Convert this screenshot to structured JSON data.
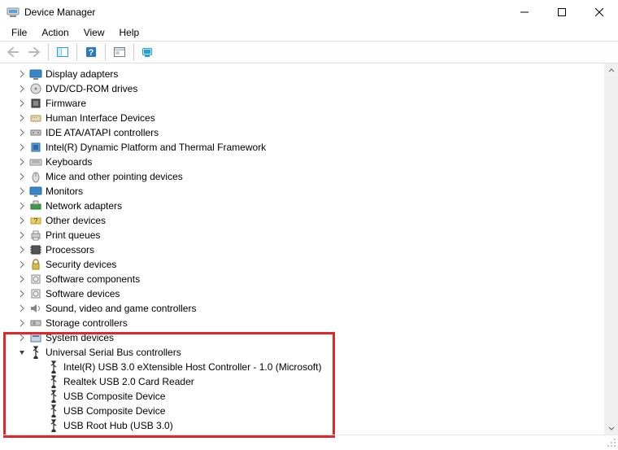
{
  "window": {
    "title": "Device Manager"
  },
  "menu": {
    "file": "File",
    "action": "Action",
    "view": "View",
    "help": "Help"
  },
  "categories": [
    {
      "label": "Display adapters",
      "icon": "display",
      "expanded": false
    },
    {
      "label": "DVD/CD-ROM drives",
      "icon": "disc",
      "expanded": false
    },
    {
      "label": "Firmware",
      "icon": "firmware",
      "expanded": false
    },
    {
      "label": "Human Interface Devices",
      "icon": "hid",
      "expanded": false
    },
    {
      "label": "IDE ATA/ATAPI controllers",
      "icon": "ide",
      "expanded": false
    },
    {
      "label": "Intel(R) Dynamic Platform and Thermal Framework",
      "icon": "chip",
      "expanded": false
    },
    {
      "label": "Keyboards",
      "icon": "keyboard",
      "expanded": false
    },
    {
      "label": "Mice and other pointing devices",
      "icon": "mouse",
      "expanded": false
    },
    {
      "label": "Monitors",
      "icon": "monitor",
      "expanded": false
    },
    {
      "label": "Network adapters",
      "icon": "network",
      "expanded": false
    },
    {
      "label": "Other devices",
      "icon": "other",
      "expanded": false
    },
    {
      "label": "Print queues",
      "icon": "printer",
      "expanded": false
    },
    {
      "label": "Processors",
      "icon": "cpu",
      "expanded": false
    },
    {
      "label": "Security devices",
      "icon": "security",
      "expanded": false
    },
    {
      "label": "Software components",
      "icon": "sw",
      "expanded": false
    },
    {
      "label": "Software devices",
      "icon": "sw",
      "expanded": false
    },
    {
      "label": "Sound, video and game controllers",
      "icon": "sound",
      "expanded": false
    },
    {
      "label": "Storage controllers",
      "icon": "storage",
      "expanded": false
    },
    {
      "label": "System devices",
      "icon": "system",
      "expanded": false
    },
    {
      "label": "Universal Serial Bus controllers",
      "icon": "usb",
      "expanded": true,
      "children": [
        {
          "label": "Intel(R) USB 3.0 eXtensible Host Controller - 1.0 (Microsoft)",
          "icon": "usb"
        },
        {
          "label": "Realtek USB 2.0 Card Reader",
          "icon": "usb"
        },
        {
          "label": "USB Composite Device",
          "icon": "usb"
        },
        {
          "label": "USB Composite Device",
          "icon": "usb"
        },
        {
          "label": "USB Root Hub (USB 3.0)",
          "icon": "usb"
        }
      ]
    }
  ]
}
